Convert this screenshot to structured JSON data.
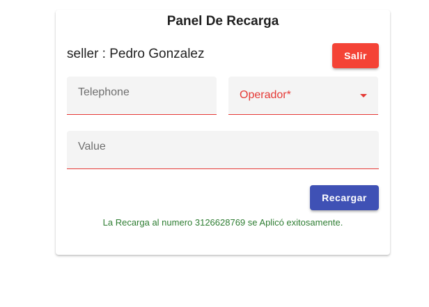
{
  "panel": {
    "title": "Panel De Recarga",
    "seller_text": "seller : Pedro Gonzalez",
    "logout_label": "Salir"
  },
  "form": {
    "telephone_placeholder": "Telephone",
    "operator_label": "Operador*",
    "value_placeholder": "Value",
    "submit_label": "Recargar"
  },
  "status": {
    "message": "La Recarga al numero 3126628769 se Aplicó exitosamente."
  },
  "colors": {
    "danger": "#f44336",
    "primary": "#3f51b5",
    "success": "#2e7d32",
    "field_underline": "#e53935"
  }
}
